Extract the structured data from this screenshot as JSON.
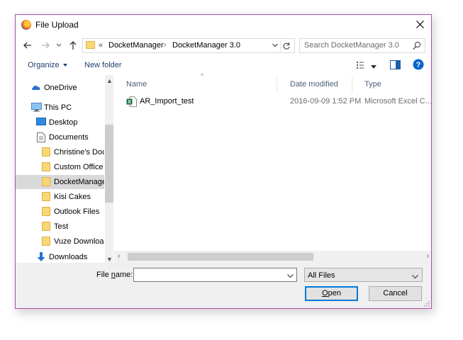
{
  "window": {
    "title": "File Upload",
    "app_icon": "firefox-icon"
  },
  "nav": {
    "address_overflow": "«",
    "path": [
      "DocketManager",
      "DocketManager 3.0"
    ],
    "search_placeholder": "Search DocketManager 3.0"
  },
  "toolbar": {
    "organize_label": "Organize",
    "new_folder_label": "New folder"
  },
  "tree": [
    {
      "label": "OneDrive",
      "icon": "cloud-icon",
      "level": 0,
      "selected": false
    },
    {
      "label": "This PC",
      "icon": "monitor-icon",
      "level": 0,
      "selected": false
    },
    {
      "label": "Desktop",
      "icon": "desktop-icon",
      "level": 1,
      "selected": false
    },
    {
      "label": "Documents",
      "icon": "documents-icon",
      "level": 1,
      "selected": false
    },
    {
      "label": "Christine's Doc",
      "icon": "folder-icon",
      "level": 2,
      "selected": false
    },
    {
      "label": "Custom Office",
      "icon": "folder-icon",
      "level": 2,
      "selected": false
    },
    {
      "label": "DocketManage",
      "icon": "folder-icon",
      "level": 2,
      "selected": true
    },
    {
      "label": "Kisi Cakes",
      "icon": "folder-icon",
      "level": 2,
      "selected": false
    },
    {
      "label": "Outlook Files",
      "icon": "folder-icon",
      "level": 2,
      "selected": false
    },
    {
      "label": "Test",
      "icon": "folder-icon",
      "level": 2,
      "selected": false
    },
    {
      "label": "Vuze Download",
      "icon": "folder-icon",
      "level": 2,
      "selected": false
    },
    {
      "label": "Downloads",
      "icon": "download-arrow-icon",
      "level": 1,
      "selected": false
    }
  ],
  "columns": {
    "name": "Name",
    "date": "Date modified",
    "type": "Type"
  },
  "files": [
    {
      "name": "AR_Import_test",
      "date": "2016-09-09 1:52 PM",
      "type": "Microsoft Excel C...",
      "icon": "excel-icon"
    }
  ],
  "footer": {
    "file_name_label_pre": "File ",
    "file_name_label_accel": "n",
    "file_name_label_post": "ame:",
    "file_name_value": "",
    "filter_selected": "All Files",
    "open_accel": "O",
    "open_rest": "pen",
    "cancel_label": "Cancel"
  },
  "colors": {
    "accent_border": "#b04ab0",
    "link": "#1e3e6e",
    "focus_blue": "#0078d7",
    "help_blue": "#0066cc"
  }
}
